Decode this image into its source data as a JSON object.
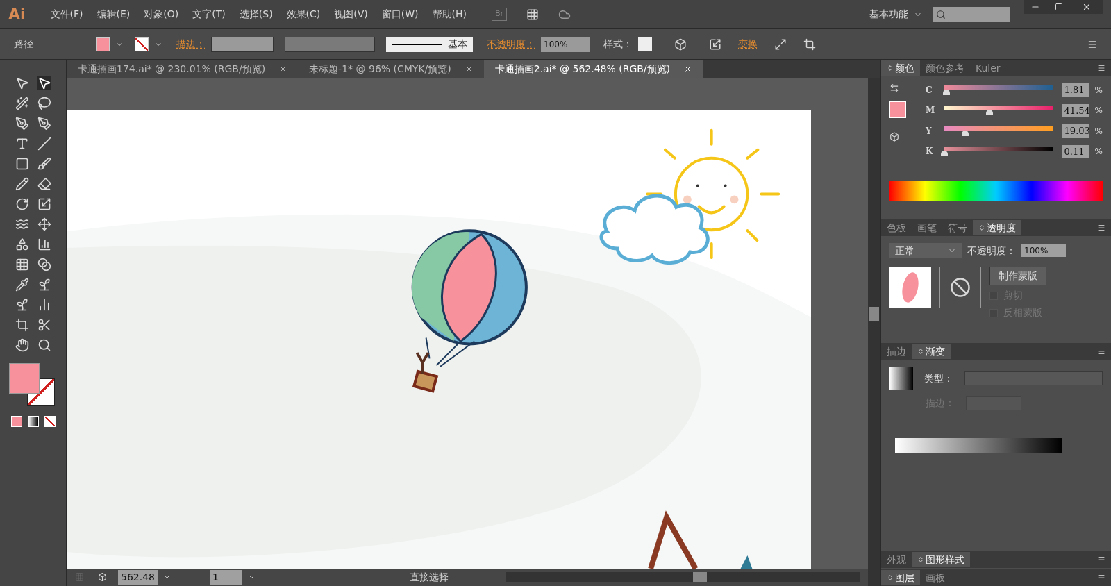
{
  "app": {
    "logo": "Ai",
    "bridge": "Br",
    "workspace": "基本功能"
  },
  "menu": [
    "文件(F)",
    "编辑(E)",
    "对象(O)",
    "文字(T)",
    "选择(S)",
    "效果(C)",
    "视图(V)",
    "窗口(W)",
    "帮助(H)"
  ],
  "control_bar": {
    "object_type": "路径",
    "stroke_label": "描边：",
    "stroke_profile": "基本",
    "opacity_label": "不透明度：",
    "opacity_value": "100%",
    "style_label": "样式：",
    "transform_link": "变换"
  },
  "doc_tabs": [
    {
      "label": "卡通插画174.ai* @ 230.01% (RGB/预览)",
      "selected": false
    },
    {
      "label": "未标题-1* @ 96% (CMYK/预览)",
      "selected": false
    },
    {
      "label": "卡通插画2.ai* @ 562.48% (RGB/预览)",
      "selected": true
    }
  ],
  "color_panel": {
    "tabs": [
      {
        "label": "颜色",
        "selected": true
      },
      {
        "label": "颜色参考",
        "selected": false
      },
      {
        "label": "Kuler",
        "selected": false
      }
    ],
    "channels": [
      {
        "name": "C",
        "level": 0.0181,
        "value": "1.81",
        "unit": "%"
      },
      {
        "name": "M",
        "level": 0.4154,
        "value": "41.54",
        "unit": "%"
      },
      {
        "name": "Y",
        "level": 0.1903,
        "value": "19.03",
        "unit": "%"
      },
      {
        "name": "K",
        "level": 0.0011,
        "value": "0.11",
        "unit": "%"
      }
    ]
  },
  "transparency_panel": {
    "tabs": [
      {
        "label": "色板",
        "selected": false
      },
      {
        "label": "画笔",
        "selected": false
      },
      {
        "label": "符号",
        "selected": false
      },
      {
        "label": "透明度",
        "selected": true
      }
    ],
    "blend_mode": "正常",
    "opacity_label": "不透明度：",
    "opacity_value": "100%",
    "mask_button": "制作蒙版",
    "options": [
      {
        "label": "剪切",
        "checked": false
      },
      {
        "label": "反相蒙版",
        "checked": false
      }
    ]
  },
  "gradient_panel": {
    "tabs": [
      {
        "label": "描边",
        "selected": false
      },
      {
        "label": "渐变",
        "selected": true
      }
    ],
    "type_label": "类型：",
    "stroke_label": "描边："
  },
  "appearance_panel": {
    "tabs": [
      {
        "label": "外观",
        "selected": false
      },
      {
        "label": "图形样式",
        "selected": true
      }
    ]
  },
  "layers_panel": {
    "tabs": [
      {
        "label": "图层",
        "selected": true
      },
      {
        "label": "画板",
        "selected": false
      }
    ]
  },
  "status_bar": {
    "zoom": "562.48",
    "page": "1",
    "tool": "直接选择"
  }
}
